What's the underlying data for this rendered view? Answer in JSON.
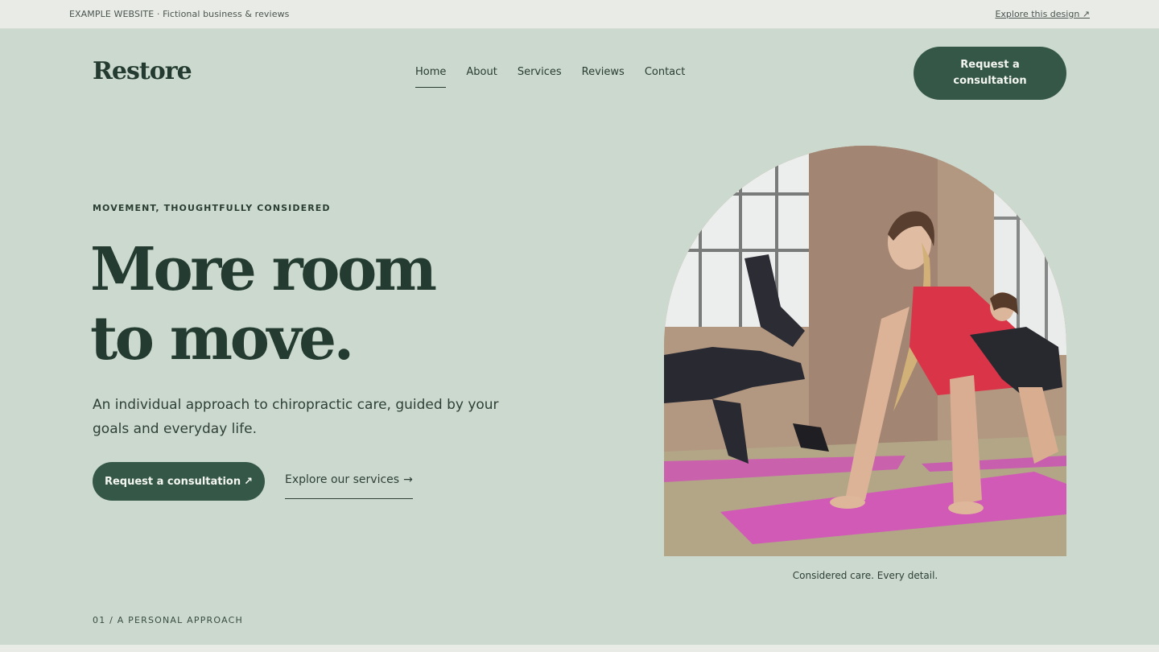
{
  "topbar": {
    "left_text": "EXAMPLE WEBSITE · Fictional business & reviews",
    "right_link": "Explore this design ↗"
  },
  "header": {
    "logo": "Restore",
    "nav": [
      "Home",
      "About",
      "Services",
      "Reviews",
      "Contact"
    ],
    "active_nav": "Home",
    "cta": "Request a consultation"
  },
  "hero": {
    "eyebrow": "MOVEMENT, THOUGHTFULLY CONSIDERED",
    "headline_line1": "More room",
    "headline_line2": "to move.",
    "subtitle": "An individual approach to chiropractic care, guided by your goals and everyday life.",
    "primary_cta": "Request a consultation",
    "primary_cta_icon": "↗",
    "secondary_cta": "Explore our services",
    "secondary_cta_icon": "→",
    "image_alt": "Women exercising on pink yoga mats in a bright studio",
    "caption": "Considered care. Every detail."
  },
  "section": {
    "label": "01 / A PERSONAL APPROACH"
  },
  "colors": {
    "background": "#ccd9ce",
    "accent": "#355747",
    "text": "#233b30",
    "topbar": "#e9ebe6"
  }
}
